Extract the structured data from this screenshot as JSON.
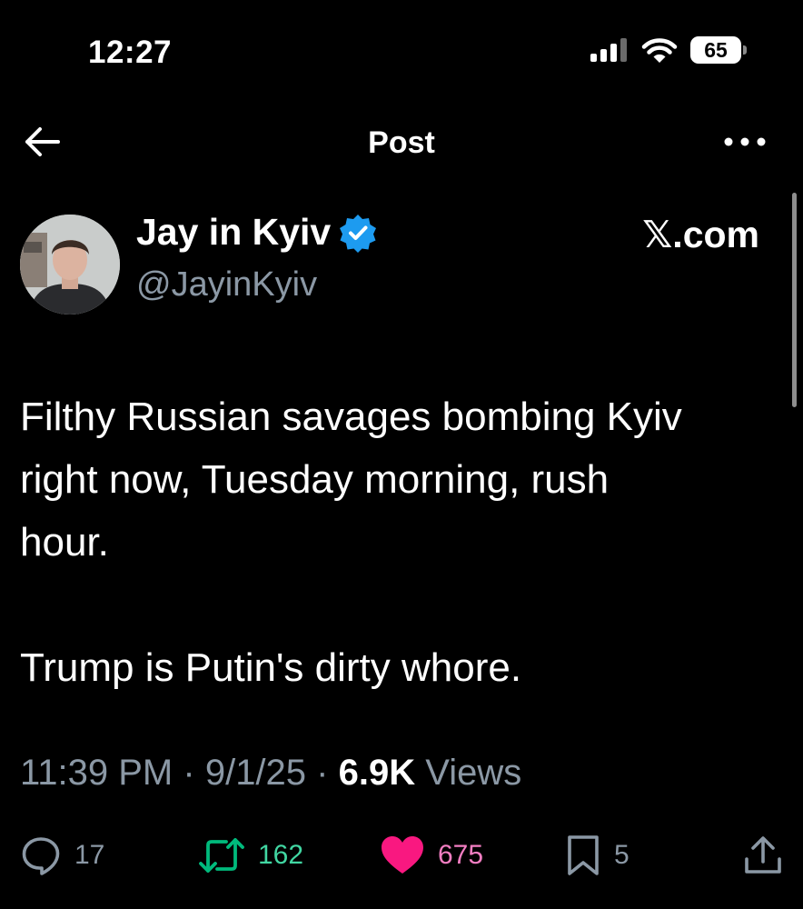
{
  "status_bar": {
    "time": "12:27",
    "battery": "65",
    "icons": [
      "signal-icon",
      "wifi-icon",
      "battery-icon"
    ]
  },
  "nav": {
    "title": "Post",
    "icons": [
      "back-arrow-icon",
      "more-icon"
    ]
  },
  "post": {
    "author_name": "Jay in Kyiv",
    "author_handle": "@JayinKyiv",
    "verified": true,
    "brand": "𝕏.com",
    "paragraphs": [
      "Filthy Russian savages bombing Kyiv\nright now, Tuesday morning, rush\nhour.",
      "Trump is Putin's dirty whore."
    ],
    "meta": {
      "time": "11:39 PM",
      "separator": "·",
      "date": "9/1/25",
      "views_count": "6.9K",
      "views_label": "Views"
    },
    "actions": {
      "replies": "17",
      "reposts": "162",
      "likes": "675",
      "bookmarks": "5"
    }
  },
  "colors": {
    "background": "#000000",
    "text": "#ffffff",
    "secondary": "#8b98a5",
    "verified": "#1d9bf0",
    "repost": "#00ba7c",
    "like": "#f91880"
  }
}
